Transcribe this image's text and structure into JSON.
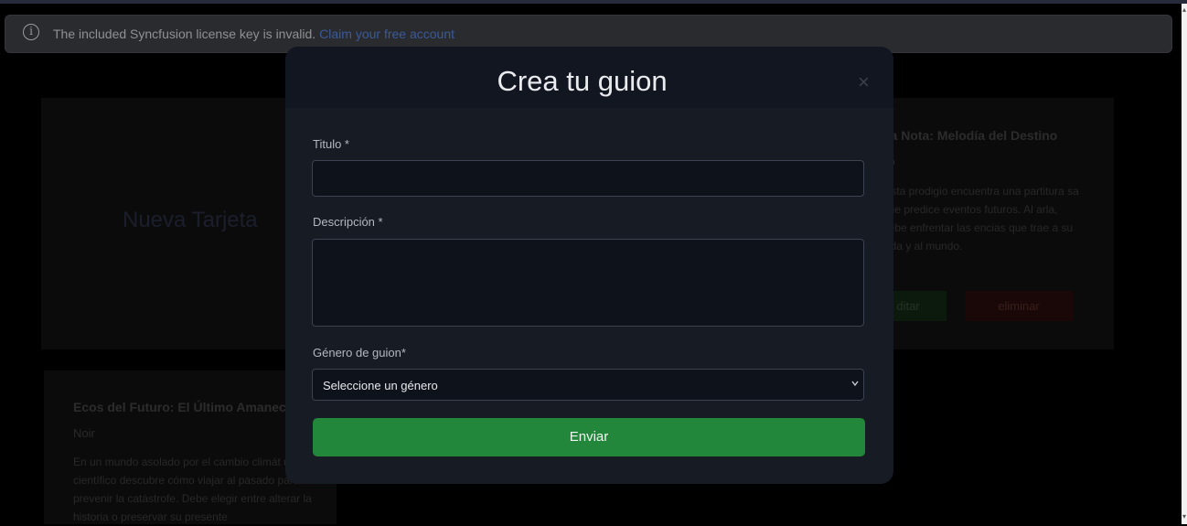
{
  "license_banner": {
    "text": "The included Syncfusion license key is invalid.",
    "link": "Claim your free account"
  },
  "background": {
    "new_card_label": "Nueva Tarjeta",
    "card_right": {
      "title": "na Nota: Melodía del Destino",
      "genre": "co",
      "description": "nista prodigio encuentra una partitura sa que predice eventos futuros. Al arla, debe enfrentar las encias que trae a su vida y al mundo.",
      "edit_label": "ditar",
      "delete_label": "eliminar"
    },
    "card_left": {
      "title": "Ecos del Futuro: El Último Amanece",
      "genre": "Noir",
      "description": "En un mundo asolado por el cambio climát un científico descubre cómo viajar al pasado para prevenir la catástrofe. Debe elegir entre alterar la historia o preservar su presente"
    }
  },
  "modal": {
    "title": "Crea tu guion",
    "close_glyph": "×",
    "title_field": {
      "label": "Titulo *",
      "value": ""
    },
    "description_field": {
      "label": "Descripción *",
      "value": ""
    },
    "genre_field": {
      "label": "Género de guion*",
      "selected": "Seleccione un género"
    },
    "submit_label": "Enviar"
  },
  "colors": {
    "accent_green": "#22873a",
    "modal_bg": "#171b24",
    "link_blue": "#3a5a9a"
  }
}
